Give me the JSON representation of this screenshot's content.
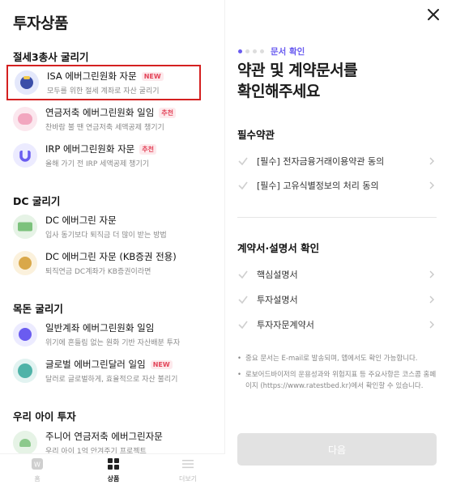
{
  "left": {
    "title": "투자상품",
    "sections": [
      {
        "title": "절세3총사 굴리기",
        "items": [
          {
            "name": "ISA 에버그린원화 자문",
            "badge": "NEW",
            "desc": "모두를 위한 절세 계좌로 자산 굴리기",
            "icon": "isa-icon"
          },
          {
            "name": "연금저축 에버그린원화 일임",
            "badge": "추천",
            "desc": "찬바람 불 땐 연금저축 세액공제 챙기기",
            "icon": "piggy-bank-icon"
          },
          {
            "name": "IRP 에버그린원화 자문",
            "badge": "추천",
            "desc": "올해 가기 전 IRP 세액공제 챙기기",
            "icon": "magnet-icon"
          }
        ]
      },
      {
        "title": "DC 굴리기",
        "items": [
          {
            "name": "DC 에버그린 자문",
            "badge": "",
            "desc": "입사 동기보다 퇴직금 더 많이 받는 방법",
            "icon": "money-stack-icon"
          },
          {
            "name": "DC 에버그린 자문 (KB증권 전용)",
            "badge": "",
            "desc": "퇴직연금 DC계좌가 KB증권이라면",
            "icon": "money-bag-icon"
          }
        ]
      },
      {
        "title": "목돈 굴리기",
        "items": [
          {
            "name": "일반계좌 에버그린원화 일임",
            "badge": "",
            "desc": "위기에 흔들림 없는 원화 기반 자산배분 투자",
            "icon": "won-coin-icon"
          },
          {
            "name": "글로벌 에버그린달러 일임",
            "badge": "NEW",
            "desc": "달러로 글로벌하게, 효율적으로 자산 불리기",
            "icon": "globe-icon"
          }
        ]
      },
      {
        "title": "우리 아이 투자",
        "items": [
          {
            "name": "주니어 연금저축 에버그린자문",
            "badge": "",
            "desc": "우리 아이 1억 안겨주기 프로젝트",
            "icon": "sprout-icon"
          }
        ]
      }
    ],
    "tabs": [
      {
        "label": "홈",
        "icon": "home-icon"
      },
      {
        "label": "상품",
        "icon": "grid-icon"
      },
      {
        "label": "더보기",
        "icon": "menu-icon"
      }
    ]
  },
  "right": {
    "step_label": "문서 확인",
    "heading_line1": "약관 및 계약문서를",
    "heading_line2": "확인해주세요",
    "required_title": "필수약관",
    "required_items": [
      "[필수] 전자금융거래이용약관 동의",
      "[필수] 고유식별정보의 처리 동의"
    ],
    "contract_title": "계약서·설명서 확인",
    "contract_items": [
      "핵심설명서",
      "투자설명서",
      "투자자문계약서"
    ],
    "notes": [
      "중요 문서는 E-mail로 발송되며, 앱에서도 확인 가능합니다.",
      "로보어드바이저의 운용성과와 위험지표 등 주요사항은 코스콤 홈페이지 (https://www.ratestbed.kr)에서 확인할 수 있습니다."
    ],
    "next_label": "다음"
  },
  "colors": {
    "accent": "#6a5cf0",
    "badge_red": "#e3455a",
    "selection_border": "#d42020",
    "disabled_button": "#e2e2e2"
  }
}
